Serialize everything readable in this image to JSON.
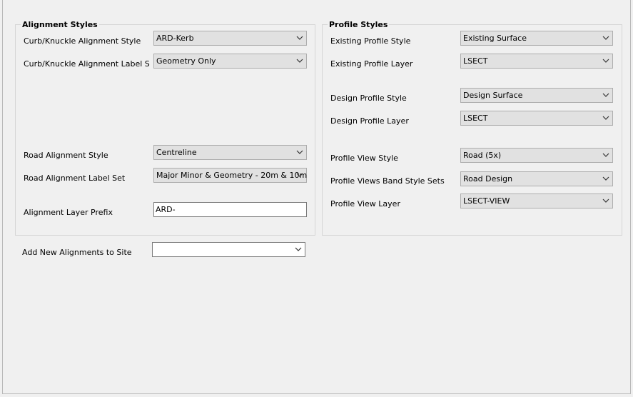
{
  "alignment_styles": {
    "title": "Alignment Styles",
    "curb_style": {
      "label": "Curb/Knuckle Alignment Style",
      "value": "ARD-Kerb"
    },
    "curb_label_set": {
      "label": "Curb/Knuckle Alignment Label S",
      "value": "Geometry Only"
    },
    "road_style": {
      "label": "Road Alignment Style",
      "value": "Centreline"
    },
    "road_label_set": {
      "label": "Road Alignment Label Set",
      "value": "Major Minor & Geometry - 20m & 10m"
    },
    "layer_prefix": {
      "label": "Alignment Layer Prefix",
      "value": "ARD-"
    }
  },
  "profile_styles": {
    "title": "Profile Styles",
    "existing_style": {
      "label": "Existing Profile Style",
      "value": "Existing Surface"
    },
    "existing_layer": {
      "label": "Existing Profile Layer",
      "value": "LSECT"
    },
    "design_style": {
      "label": "Design Profile Style",
      "value": "Design Surface"
    },
    "design_layer": {
      "label": "Design Profile Layer",
      "value": "LSECT"
    },
    "view_style": {
      "label": "Profile View Style",
      "value": "Road (5x)"
    },
    "band_style_sets": {
      "label": "Profile Views Band Style Sets",
      "value": "Road Design"
    },
    "view_layer": {
      "label": "Profile View Layer",
      "value": "LSECT-VIEW"
    }
  },
  "site": {
    "label": "Add New Alignments to Site",
    "value": ""
  },
  "icons": {
    "dropdown": "chevron-down-icon"
  }
}
